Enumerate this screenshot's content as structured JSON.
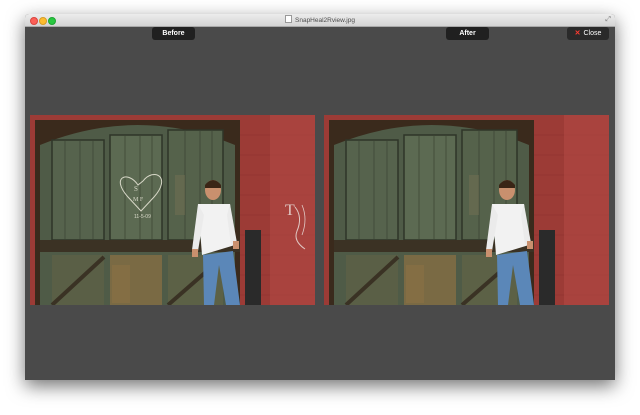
{
  "window": {
    "title": "SnapHeal2Rview.jpg",
    "background": "#4a4a4a"
  },
  "panels": {
    "before": {
      "label": "Before"
    },
    "after": {
      "label": "After"
    }
  },
  "toolbar": {
    "close_label": "Close",
    "close_icon": "close-x-icon"
  },
  "photo": {
    "heart_text_line1": "S",
    "heart_text_line2": "M F",
    "carved_date": "11-5-09",
    "wall_graffiti": "T"
  }
}
